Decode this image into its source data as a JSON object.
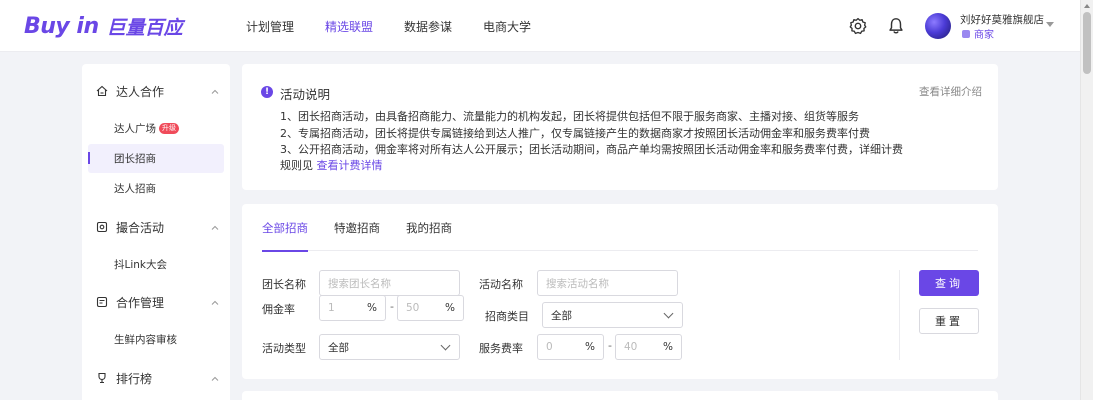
{
  "brand": {
    "logo_en": "Buy in",
    "logo_cn": "巨量百应"
  },
  "nav": {
    "items": [
      "计划管理",
      "精选联盟",
      "数据参谋",
      "电商大学"
    ],
    "active_index": 1
  },
  "user": {
    "shop_name": "刘好好莫雅旗舰店",
    "role": "商家"
  },
  "sidebar": {
    "sections": [
      {
        "title": "达人合作",
        "icon": "handshake-icon",
        "items": [
          {
            "label": "达人广场",
            "badge": "升级"
          },
          {
            "label": "团长招商"
          },
          {
            "label": "达人招商"
          }
        ]
      },
      {
        "title": "撮合活动",
        "icon": "activity-icon",
        "items": [
          {
            "label": "抖Link大会"
          }
        ]
      },
      {
        "title": "合作管理",
        "icon": "contract-icon",
        "items": [
          {
            "label": "生鲜内容审核"
          }
        ]
      },
      {
        "title": "排行榜",
        "icon": "trophy-icon",
        "items": []
      }
    ],
    "active_item": "团长招商"
  },
  "activity": {
    "title": "活动说明",
    "lines": [
      "1、团长招商活动，由具备招商能力、流量能力的机构发起，团长将提供包括但不限于服务商家、主播对接、组货等服务",
      "2、专属招商活动，团长将提供专属链接给到达人推广，仅专属链接产生的数据商家才按照团长活动佣金率和服务费率付费",
      "3、公开招商活动，佣金率将对所有达人公开展示；团长活动期间，商品产单均需按照团长活动佣金率和服务费率付费，详细计费",
      "规则见"
    ],
    "rule_link": "查看计费详情",
    "more_link": "查看详细介绍"
  },
  "search": {
    "tabs": [
      "全部招商",
      "特邀招商",
      "我的招商"
    ],
    "active_tab": 0,
    "fields": {
      "leader_name": {
        "label": "团长名称",
        "placeholder": "搜索团长名称"
      },
      "activity_name": {
        "label": "活动名称",
        "placeholder": "搜索活动名称"
      },
      "commission": {
        "label": "佣金率",
        "min_placeholder": "1",
        "max_placeholder": "50",
        "unit": "%"
      },
      "category": {
        "label": "招商类目",
        "value": "全部"
      },
      "activity_type": {
        "label": "活动类型",
        "value": "全部"
      },
      "service_fee": {
        "label": "服务费率",
        "min_placeholder": "0",
        "max_placeholder": "40",
        "unit": "%"
      }
    },
    "range_separator": "-",
    "query_button": "查询",
    "reset_button": "重置"
  },
  "colors": {
    "accent": "#6a47e6",
    "badge": "#f04b5a"
  }
}
